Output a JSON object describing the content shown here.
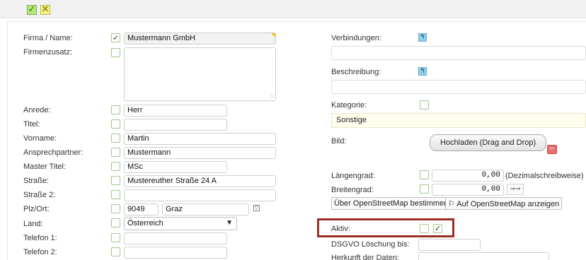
{
  "toolbar": {
    "ok_icon": "✓",
    "cancel_icon": "✕"
  },
  "left": {
    "firma_label": "Firma / Name:",
    "firma_checked": "✓",
    "firma_value": "Mustermann GmbH",
    "zusatz_label": "Firmenzusatz:",
    "zusatz_grip": "∷",
    "anrede_label": "Anrede:",
    "anrede_value": "Herr",
    "titel_label": "Titel:",
    "titel_value": "",
    "vorname_label": "Vorname:",
    "vorname_value": "Martin",
    "ansprech_label": "Ansprechpartner:",
    "ansprech_value": "Mustermann",
    "master_label": "Master Titel:",
    "master_value": "MSc",
    "strasse_label": "Straße:",
    "strasse_value": "Mustereuther Straße 24 A",
    "strasse2_label": "Straße 2:",
    "strasse2_value": "",
    "plz_label": "Plz/Ort:",
    "plz_value": "9049",
    "ort_value": "Graz",
    "filter_icon": "▽",
    "land_label": "Land:",
    "land_value": "Österreich",
    "land_caret": "▼",
    "tel1_label": "Telefon 1:",
    "tel1_value": "",
    "tel2_label": "Telefon 2:",
    "tel2_value": ""
  },
  "right": {
    "verbindungen_label": "Verbindungen:",
    "pin_icon": "↰",
    "beschreibung_label": "Beschreibung:",
    "kategorie_label": "Kategorie:",
    "kategorie_value": "Sonstige",
    "bild_label": "Bild:",
    "upload_label": "Hochladen (Drag and Drop)",
    "minus_icon": "−",
    "laengen_label": "Längengrad:",
    "laengen_value": "0,00",
    "dezimal_label": "(Dezimalschreibweise)",
    "breiten_label": "Breitengrad:",
    "breiten_value": "0,00",
    "dbl_icon": "⇒⇒",
    "osm_bestimmen": "Über OpenStreetMap bestimmen",
    "osm_anzeigen": "⚐ Auf OpenStreetMap anzeigen",
    "aktiv_label": "Aktiv:",
    "aktiv_checked": "✓",
    "dsgvo_label": "DSGVO Löschung bis:",
    "herkunft_label": "Herkunft der Daten:"
  },
  "colors": {
    "highlight": "#9a3024",
    "checkbox_border": "#9cc98a",
    "required_corner": "#f0c600"
  }
}
